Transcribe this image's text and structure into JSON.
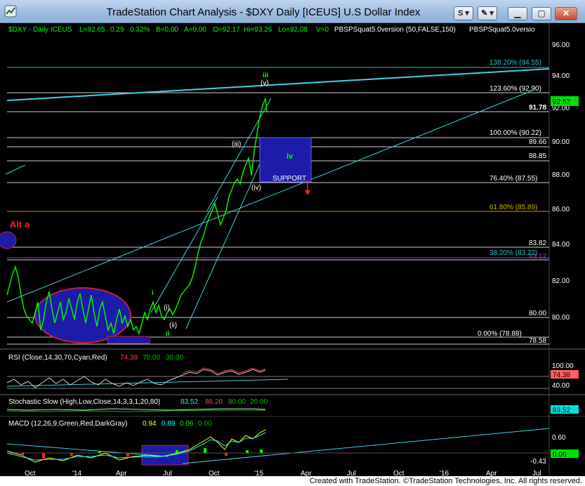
{
  "window": {
    "title": "TradeStation Chart Analysis - $DXY Daily [ICEUS] U.S Dollar Index",
    "btn_s": "S",
    "btn_wrench": "✎"
  },
  "header": {
    "symbol": "$DXY - Daily  ICEUS",
    "last": "L=92.65",
    "change": "0.29",
    "pct": "0.32%",
    "bid": "B=0.00",
    "ask": "A=0.00",
    "open": "O=92.17",
    "high": "Hi=93.26",
    "low": "Lo=92.08",
    "vol": "V=0",
    "indicator1": "PBSPSquat5.0version (50,FALSE,150)",
    "indicator2": "PBSPSquat5.0versio"
  },
  "price_axis": {
    "ticks": [
      "96.00",
      "94.00",
      "92.00",
      "90.00",
      "88.00",
      "86.00",
      "84.00",
      "82.00",
      "80.00"
    ],
    "last_price": "92.52"
  },
  "fib_labels": {
    "f138": "138.20% (94.55)",
    "f123": "123.60% (92.90)",
    "f100": "100.00% (90.22)",
    "f76": "76.40% (87.55)",
    "f61": "61.80% (85.89)",
    "f38": "38.20% (83.22)",
    "f0": "0.00% (78.88)"
  },
  "level_labels": {
    "l9178": "91.78",
    "l8966": "89.66",
    "l8885": "88.85",
    "l8382": "83.82",
    "l8312": "83.12",
    "l8000": "80.00",
    "l7858": "78.58"
  },
  "wave_labels": {
    "iii": "iii",
    "v": "(v)",
    "iii_paren": "(iii)",
    "iv": "iv",
    "iv_paren": "(iv)",
    "i": "i",
    "i_paren": "(i)",
    "ii": "ii",
    "ii_paren": "(ii)",
    "support": "SUPPORT",
    "alt_a": "Alt a"
  },
  "rsi": {
    "label": "RSI (Close,14,30,70,Cyan,Red)",
    "v1": "74.38",
    "v2": "70.00",
    "v3": "30.00",
    "ticks": [
      "100.00",
      "40.00"
    ],
    "current": "74.38"
  },
  "stoch": {
    "label": "Stochastic Slow (High,Low,Close,14,3,3,1,20,80)",
    "v1": "83.52",
    "v2": "86.20",
    "v3": "80.00",
    "v4": "20.00",
    "current": "83.52"
  },
  "macd": {
    "label": "MACD (12,26,9,Green,Red,DarkGray)",
    "v1": "0.94",
    "v2": "0.89",
    "v3": "0.06",
    "v4": "0.00",
    "ticks": [
      "0.60",
      "-0.43"
    ],
    "current": "0.06"
  },
  "time_axis": [
    "Oct",
    "'14",
    "Apr",
    "Jul",
    "Oct",
    "'15",
    "Apr",
    "Jul",
    "Oct",
    "'16",
    "Apr",
    "Jul"
  ],
  "footer": "Created with TradeStation. ©TradeStation Technologies, Inc. All rights reserved.",
  "colors": {
    "cyan": "#00ffff",
    "green": "#00ff00",
    "blue_box": "#1c1ca8",
    "red": "#ff2020",
    "olive": "#c8b400"
  }
}
